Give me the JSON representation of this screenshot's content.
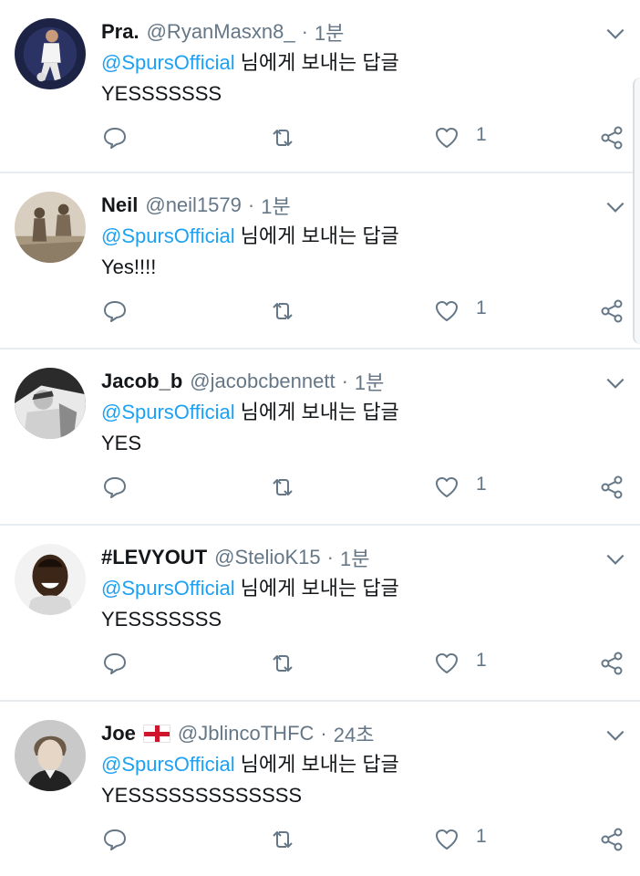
{
  "theme": {
    "accent": "#1da1f2",
    "secondary_text": "#657786",
    "divider": "#e6ecf0"
  },
  "tweets": [
    {
      "name": "Pra.",
      "handle": "@RyanMasxn8_",
      "time": "1분",
      "mention": "@SpursOfficial",
      "reply_suffix": "님에게 보내는 답글",
      "text": "YESSSSSSS",
      "likes": "1",
      "flag": ""
    },
    {
      "name": "Neil",
      "handle": "@neil1579",
      "time": "1분",
      "mention": "@SpursOfficial",
      "reply_suffix": "님에게 보내는 답글",
      "text": "Yes!!!!",
      "likes": "1",
      "flag": ""
    },
    {
      "name": "Jacob_b",
      "handle": "@jacobcbennett",
      "time": "1분",
      "mention": "@SpursOfficial",
      "reply_suffix": "님에게 보내는 답글",
      "text": "YES",
      "likes": "1",
      "flag": ""
    },
    {
      "name": "#LEVYOUT",
      "handle": "@StelioK15",
      "time": "1분",
      "mention": "@SpursOfficial",
      "reply_suffix": "님에게 보내는 답글",
      "text": "YESSSSSSS",
      "likes": "1",
      "flag": ""
    },
    {
      "name": "Joe",
      "handle": "@JblincoTHFC",
      "time": "24초",
      "mention": "@SpursOfficial",
      "reply_suffix": "님에게 보내는 답글",
      "text": "YESSSSSSSSSSSSS",
      "likes": "1",
      "flag": "england-flag"
    }
  ],
  "icons": {
    "reply": "reply-icon",
    "retweet": "retweet-icon",
    "like": "heart-icon",
    "share": "share-icon",
    "more": "chevron-down-icon"
  }
}
